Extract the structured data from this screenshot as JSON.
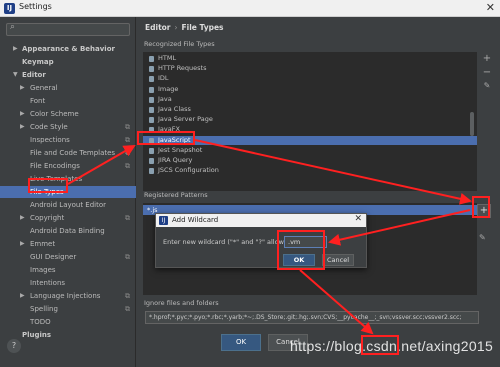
{
  "window": {
    "title": "Settings",
    "close_glyph": "✕",
    "app_icon": "IJ"
  },
  "sidebar": {
    "help_glyph": "?",
    "items": [
      {
        "label": "Appearance & Behavior",
        "arrow": "▶",
        "bold": true
      },
      {
        "label": "Keymap",
        "arrow": "",
        "bold": true
      },
      {
        "label": "Editor",
        "arrow": "▼",
        "bold": true
      },
      {
        "label": "General",
        "arrow": "▶"
      },
      {
        "label": "Font",
        "arrow": ""
      },
      {
        "label": "Color Scheme",
        "arrow": "▶"
      },
      {
        "label": "Code Style",
        "arrow": "▶",
        "cfg": true
      },
      {
        "label": "Inspections",
        "arrow": "",
        "cfg": true
      },
      {
        "label": "File and Code Templates",
        "arrow": "",
        "cfg": true
      },
      {
        "label": "File Encodings",
        "arrow": "",
        "cfg": true
      },
      {
        "label": "Live Templates",
        "arrow": ""
      },
      {
        "label": "File Types",
        "arrow": "",
        "selected": true
      },
      {
        "label": "Android Layout Editor",
        "arrow": ""
      },
      {
        "label": "Copyright",
        "arrow": "▶",
        "cfg": true
      },
      {
        "label": "Android Data Binding",
        "arrow": ""
      },
      {
        "label": "Emmet",
        "arrow": "▶"
      },
      {
        "label": "GUI Designer",
        "arrow": "",
        "cfg": true
      },
      {
        "label": "Images",
        "arrow": ""
      },
      {
        "label": "Intentions",
        "arrow": ""
      },
      {
        "label": "Language Injections",
        "arrow": "▶",
        "cfg": true
      },
      {
        "label": "Spelling",
        "arrow": "",
        "cfg": true
      },
      {
        "label": "TODO",
        "arrow": ""
      },
      {
        "label": "Plugins",
        "arrow": "",
        "bold": true
      }
    ]
  },
  "main": {
    "breadcrumb": {
      "parent": "Editor",
      "sep": "›",
      "current": "File Types"
    },
    "recognized_label": "Recognized File Types",
    "file_types": [
      "HTML",
      "HTTP Requests",
      "IDL",
      "Image",
      "Java",
      "Java Class",
      "Java Server Page",
      "JavaFX",
      "JavaScript",
      "Jest Snapshot",
      "JIRA Query",
      "JSCS Configuration"
    ],
    "selected_file_type": "JavaScript",
    "tools": {
      "add": "+",
      "remove": "−",
      "edit": "✎"
    },
    "registered_label": "Registered Patterns",
    "pattern": "*.js",
    "pattern_add": "+",
    "pattern_edit": "✎",
    "ignore_label": "Ignore files and folders",
    "ignore_value": "*.hprof;*.pyc;*.pyo;*.rbc;*.yarb;*~;.DS_Store;.git;.hg;.svn;CVS;__pycache__;_svn;vssver.scc;vssver2.scc;"
  },
  "dialog": {
    "title": "Add Wildcard",
    "prompt": "Enter new wildcard (\"*\" and \"?\" allowed):",
    "value": ".vm",
    "ok": "OK",
    "cancel": "Cancel",
    "close_glyph": "✕"
  },
  "footer": {
    "ok": "OK",
    "cancel": "Cancel"
  },
  "watermark": "https://blog.csdn.net/axing2015",
  "colors": {
    "annotation": "#ff2020",
    "selection": "#4b6eaf",
    "background": "#3c3f41"
  }
}
